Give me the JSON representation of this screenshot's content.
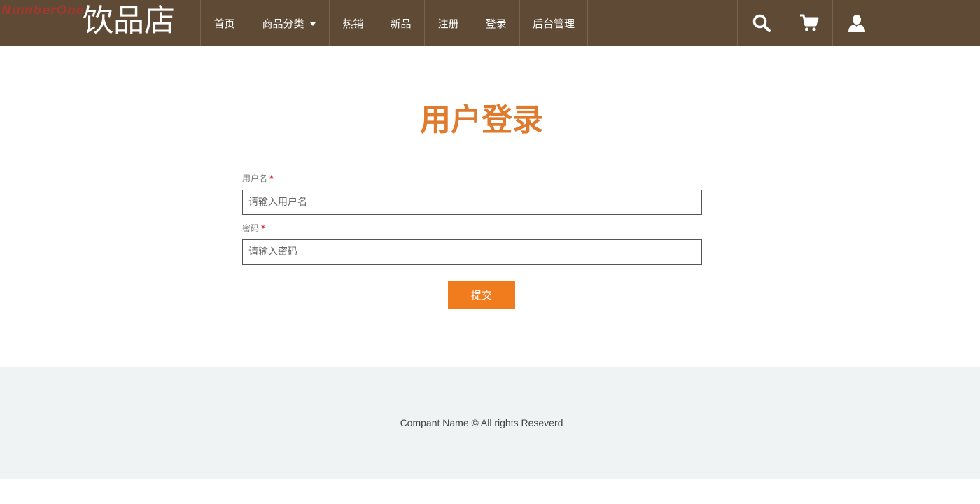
{
  "watermark": "NumberOne",
  "header": {
    "logo": "饮品店",
    "nav": [
      {
        "label": "首页"
      },
      {
        "label": "商品分类",
        "has_dropdown": true
      },
      {
        "label": "热销"
      },
      {
        "label": "新品"
      },
      {
        "label": "注册"
      },
      {
        "label": "登录"
      },
      {
        "label": "后台管理"
      }
    ],
    "icons": [
      "search-icon",
      "cart-icon",
      "user-icon"
    ]
  },
  "login": {
    "title": "用户登录",
    "username": {
      "label": "用户名",
      "required_mark": "*",
      "placeholder": "请输入用户名",
      "value": ""
    },
    "password": {
      "label": "密码",
      "required_mark": "*",
      "placeholder": "请输入密码",
      "value": ""
    },
    "submit_label": "提交"
  },
  "footer": {
    "copyright": "Compant Name © All rights Reseverd"
  },
  "colors": {
    "header_bg": "#5e4a35",
    "accent": "#f07c1e",
    "title": "#e07b2e",
    "footer_bg": "#f0f3f3",
    "required": "#d0021b"
  }
}
